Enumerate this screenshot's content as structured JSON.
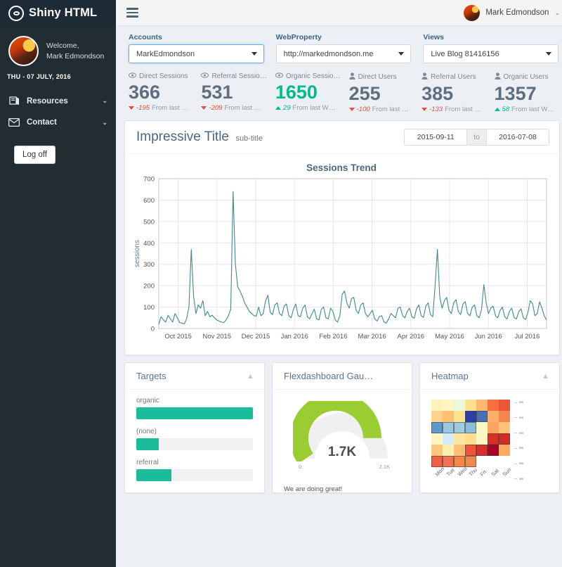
{
  "brand": {
    "title": "Shiny HTML",
    "logo_icon": "eye-icon"
  },
  "sidebar": {
    "welcome_label": "Welcome,",
    "user_name": "Mark Edmondson",
    "date_line": "THU - 07 JULY, 2016",
    "items": [
      {
        "label": "Resources",
        "icon": "book-icon",
        "chevron": "⌄"
      },
      {
        "label": "Contact",
        "icon": "envelope-icon",
        "chevron": "⌄"
      }
    ],
    "logoff_label": "Log off"
  },
  "topbar": {
    "menu_icon": "hamburger-icon",
    "user_name": "Mark Edmondson",
    "caret": "⌄"
  },
  "selectors": [
    {
      "label": "Accounts",
      "value": "MarkEdmondson",
      "focused": true
    },
    {
      "label": "WebProperty",
      "value": "http://markedmondson.me",
      "focused": false
    },
    {
      "label": "Views",
      "value": "Live Blog 81416156",
      "focused": false
    }
  ],
  "kpis": [
    {
      "icon": "eye-icon",
      "label": "Direct Sessions",
      "label_full": "Direct Sessions",
      "value": "366",
      "delta": "-195",
      "direction": "down",
      "note": "From last …"
    },
    {
      "icon": "eye-icon",
      "label": "Referral Sessio…",
      "label_full": "Referral Sessions",
      "value": "531",
      "delta": "-209",
      "direction": "down",
      "note": "From last …"
    },
    {
      "icon": "eye-icon",
      "label": "Organic Sessio…",
      "label_full": "Organic Sessions",
      "value": "1650",
      "delta": "29",
      "direction": "up",
      "note": "From last W…",
      "highlight": true
    },
    {
      "icon": "user-icon",
      "label": "Direct Users",
      "label_full": "Direct Users",
      "value": "255",
      "delta": "-100",
      "direction": "down",
      "note": "From last …"
    },
    {
      "icon": "user-icon",
      "label": "Referral Users",
      "label_full": "Referral Users",
      "value": "385",
      "delta": "-133",
      "direction": "down",
      "note": "From last …"
    },
    {
      "icon": "user-icon",
      "label": "Organic Users",
      "label_full": "Organic Users",
      "value": "1357",
      "delta": "58",
      "direction": "up",
      "note": "From last W…"
    }
  ],
  "main_panel": {
    "title": "Impressive Title",
    "subtitle": "sub-title",
    "date_start": "2015-09-11",
    "date_to": "to",
    "date_end": "2016-07-08"
  },
  "bottom_panels": {
    "targets": {
      "title": "Targets",
      "collapse_icon": "chevron-up-icon",
      "bars": [
        {
          "label": "organic",
          "percent": 100
        },
        {
          "label": "(none)",
          "percent": 19
        },
        {
          "label": "referral",
          "percent": 30
        }
      ]
    },
    "gauge": {
      "title": "Flexdashboard Gau…",
      "value_label": "1.7K",
      "min_label": "0",
      "max_label": "2.1K",
      "note": "We are doing great!",
      "color": "#9ACD32"
    },
    "heatmap": {
      "title": "Heatmap",
      "collapse_icon": "chevron-up-icon",
      "x_labels": [
        "Mon",
        "Tue",
        "Wed",
        "Thu",
        "Fri",
        "Sat",
        "Sun"
      ]
    }
  },
  "chart_data": {
    "type": "line",
    "title": "Sessions Trend",
    "xlabel": "",
    "ylabel": "sessions",
    "ylim": [
      0,
      700
    ],
    "yticks": [
      0,
      100,
      200,
      300,
      400,
      500,
      600,
      700
    ],
    "xticks": [
      "Oct 2015",
      "Nov 2015",
      "Dec 2015",
      "Jan 2016",
      "Feb 2016",
      "Mar 2016",
      "Apr 2016",
      "May 2016",
      "Jun 2016",
      "Jul 2016"
    ],
    "grid": true,
    "legend": "none",
    "line_color": "#3f8a8a",
    "series": [
      {
        "name": "sessions",
        "values": [
          20,
          55,
          40,
          30,
          62,
          45,
          30,
          70,
          50,
          28,
          25,
          22,
          45,
          100,
          370,
          150,
          70,
          110,
          95,
          130,
          60,
          80,
          55,
          62,
          50,
          40,
          35,
          30,
          28,
          40,
          60,
          90,
          640,
          300,
          195,
          175,
          150,
          120,
          100,
          80,
          70,
          60,
          58,
          100,
          60,
          70,
          130,
          155,
          75,
          65,
          110,
          120,
          70,
          60,
          105,
          115,
          60,
          50,
          90,
          115,
          60,
          55,
          95,
          110,
          55,
          45,
          70,
          90,
          45,
          40,
          90,
          100,
          50,
          45,
          95,
          80,
          40,
          30,
          60,
          160,
          175,
          120,
          95,
          140,
          145,
          85,
          70,
          110,
          120,
          70,
          55,
          70,
          85,
          45,
          35,
          55,
          60,
          30,
          25,
          45,
          70,
          60,
          50,
          95,
          100,
          60,
          50,
          80,
          95,
          55,
          48,
          92,
          110,
          60,
          52,
          105,
          120,
          65,
          55,
          200,
          370,
          150,
          95,
          130,
          145,
          85,
          70,
          120,
          135,
          80,
          65,
          115,
          125,
          70,
          60,
          100,
          110,
          60,
          50,
          90,
          205,
          120,
          70,
          95,
          105,
          60,
          50,
          85,
          100,
          55,
          45,
          80,
          95,
          52,
          44,
          78,
          92,
          50,
          42,
          76,
          130,
          115,
          60,
          70,
          125,
          95,
          60,
          40
        ]
      }
    ]
  },
  "heatmap_data": {
    "type": "heatmap",
    "x_labels": [
      "Mon",
      "Tue",
      "Wed",
      "Thu",
      "Fri",
      "Sat",
      "Sun"
    ],
    "rows": 6,
    "cols": 7,
    "cells": [
      [
        "#fdf3b8",
        "#fdf6c2",
        "#ecf7dc",
        "#fde08e",
        "#fcb86e",
        "#f4713f",
        "#ea5738"
      ],
      [
        "#fdd28a",
        "#fdbf72",
        "#fde193",
        "#2f3f9e",
        "#4a6fb5",
        "#fcb069",
        "#f58753"
      ],
      [
        "#5b9bc9",
        "#9cc9e0",
        "#9fcbe1",
        "#8cc0da",
        "#fbf8c6",
        "#fca55f",
        "#fdc178"
      ],
      [
        "#fdf6c0",
        "#d4ecf5",
        "#fde59b",
        "#fddd8e",
        "#fdf5bf",
        "#d92f26",
        "#cf2a26"
      ],
      [
        "#fdc87d",
        "#fdf0ae",
        "#fdc078",
        "#ef5439",
        "#d5302a",
        "#a60526",
        "#fcab63"
      ],
      [
        "#ef6042",
        "#f07250",
        "#f9874d",
        "#f08a50",
        "blank",
        "blank",
        "blank"
      ]
    ],
    "selected": [
      [
        1,
        3
      ],
      [
        1,
        4
      ],
      [
        2,
        0
      ],
      [
        2,
        1
      ],
      [
        2,
        2
      ],
      [
        2,
        3
      ],
      [
        3,
        5
      ],
      [
        3,
        6
      ],
      [
        4,
        3
      ],
      [
        4,
        4
      ],
      [
        4,
        5
      ],
      [
        5,
        0
      ],
      [
        5,
        1
      ],
      [
        5,
        2
      ],
      [
        5,
        3
      ]
    ]
  }
}
